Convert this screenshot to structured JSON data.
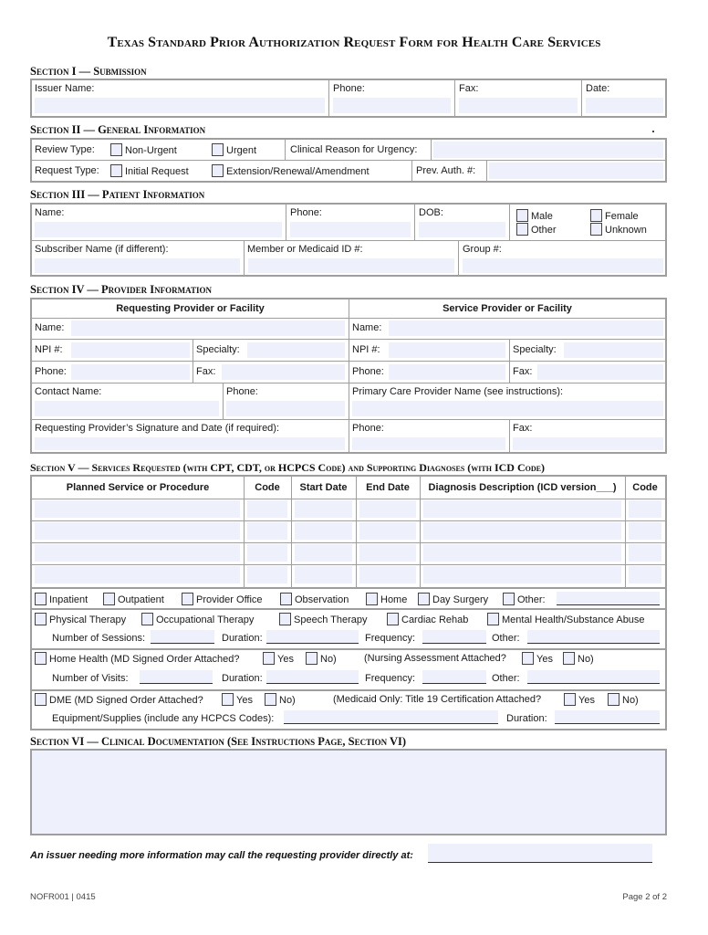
{
  "title": "Texas Standard Prior Authorization Request Form for Health Care Services",
  "section1": {
    "heading": "Section I — Submission",
    "issuer_name_label": "Issuer Name:",
    "phone_label": "Phone:",
    "fax_label": "Fax:",
    "date_label": "Date:"
  },
  "section2": {
    "heading": "Section II — General Information",
    "review_type_label": "Review Type:",
    "non_urgent_label": "Non-Urgent",
    "urgent_label": "Urgent",
    "clinical_reason_label": "Clinical Reason for Urgency:",
    "request_type_label": "Request Type:",
    "initial_request_label": "Initial Request",
    "extension_label": "Extension/Renewal/Amendment",
    "prev_auth_label": "Prev. Auth. #:"
  },
  "section3": {
    "heading": "Section III — Patient Information",
    "name_label": "Name:",
    "phone_label": "Phone:",
    "dob_label": "DOB:",
    "sex_options": [
      "Male",
      "Female",
      "Other",
      "Unknown"
    ],
    "subscriber_label": "Subscriber Name (if different):",
    "member_id_label": "Member or Medicaid ID #:",
    "group_label": "Group #:"
  },
  "section4": {
    "heading": "Section IV — Provider Information",
    "requesting": {
      "header": "Requesting Provider or Facility",
      "name_label": "Name:",
      "npi_label": "NPI #:",
      "specialty_label": "Specialty:",
      "phone_label": "Phone:",
      "fax_label": "Fax:",
      "contact_label": "Contact Name:",
      "contact_phone_label": "Phone:",
      "signature_label": "Requesting Provider’s Signature and Date (if required):"
    },
    "service": {
      "header": "Service Provider or Facility",
      "name_label": "Name:",
      "npi_label": "NPI #:",
      "specialty_label": "Specialty:",
      "phone_label": "Phone:",
      "fax_label": "Fax:",
      "pcp_label": "Primary Care Provider Name (see instructions):",
      "pcp_phone_label": "Phone:",
      "pcp_fax_label": "Fax:"
    }
  },
  "section5": {
    "heading": "Section V — Services Requested (with CPT, CDT, or HCPCS Code) and Supporting Diagnoses (with ICD Code)",
    "columns": [
      "Planned Service or Procedure",
      "Code",
      "Start Date",
      "End Date",
      "Diagnosis Description (ICD version___)",
      "Code"
    ],
    "row_count": 4,
    "settings": [
      "Inpatient",
      "Outpatient",
      "Provider Office",
      "Observation",
      "Home",
      "Day Surgery",
      "Other:"
    ],
    "therapies": [
      "Physical Therapy",
      "Occupational Therapy",
      "Speech Therapy",
      "Cardiac Rehab",
      "Mental Health/Substance Abuse"
    ],
    "sessions_label": "Number of Sessions:",
    "duration_label": "Duration:",
    "frequency_label": "Frequency:",
    "other_label": "Other:",
    "home_health_label": "Home Health (MD Signed Order Attached?",
    "yes_label": "Yes",
    "no_label": "No)",
    "nursing_label": "(Nursing Assessment Attached?",
    "visits_label": "Number of Visits:",
    "dme_label": "DME (MD Signed Order Attached?",
    "medicaid_label": "(Medicaid Only: Title 19 Certification Attached?",
    "equipment_label": "Equipment/Supplies (include any HCPCS Codes):"
  },
  "section6": {
    "heading": "Section VI — Clinical Documentation (See Instructions Page, Section VI)"
  },
  "issuer_note": "An issuer needing more information may call the requesting provider directly at:",
  "footer": {
    "form_id": "NOFR001 | 0415",
    "page": "Page 2 of 2"
  }
}
